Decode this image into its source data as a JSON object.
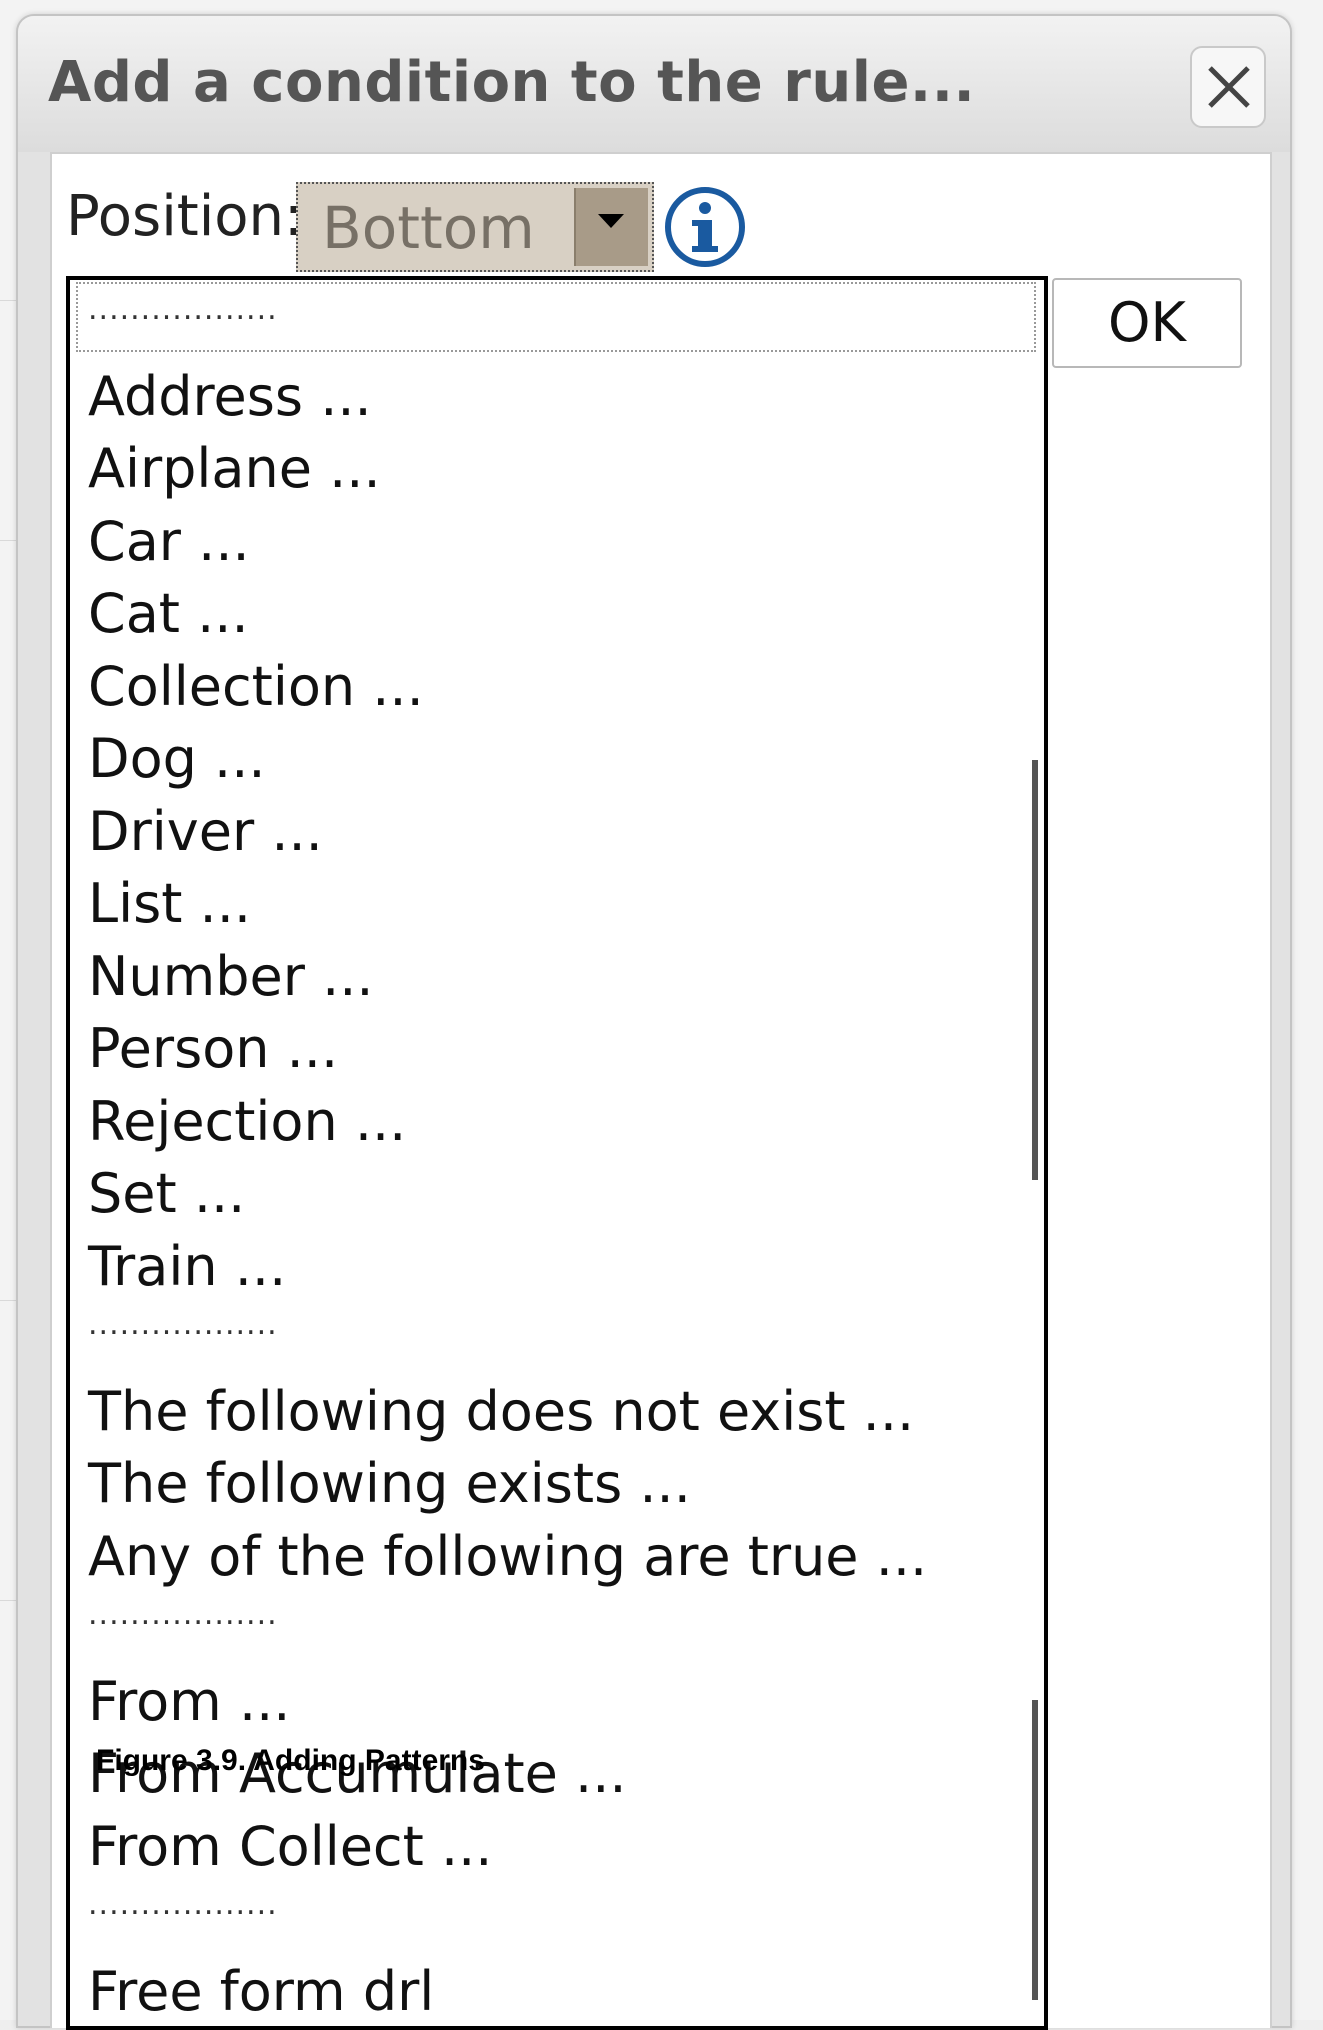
{
  "dialog": {
    "title": "Add a condition to the rule...",
    "close_icon": "close-icon"
  },
  "position": {
    "label": "Position:",
    "selected": "Bottom",
    "info_icon": "info-icon"
  },
  "ok_label": "OK",
  "pattern_list": {
    "separator_text": "..................",
    "items": [
      {
        "kind": "separator"
      },
      {
        "kind": "option",
        "label": "Address ..."
      },
      {
        "kind": "option",
        "label": "Airplane ..."
      },
      {
        "kind": "option",
        "label": "Car ..."
      },
      {
        "kind": "option",
        "label": "Cat ..."
      },
      {
        "kind": "option",
        "label": "Collection ..."
      },
      {
        "kind": "option",
        "label": "Dog ..."
      },
      {
        "kind": "option",
        "label": "Driver ..."
      },
      {
        "kind": "option",
        "label": "List ..."
      },
      {
        "kind": "option",
        "label": "Number ..."
      },
      {
        "kind": "option",
        "label": "Person ..."
      },
      {
        "kind": "option",
        "label": "Rejection ..."
      },
      {
        "kind": "option",
        "label": "Set ..."
      },
      {
        "kind": "option",
        "label": "Train ..."
      },
      {
        "kind": "separator"
      },
      {
        "kind": "option",
        "label": "The following does not exist ..."
      },
      {
        "kind": "option",
        "label": "The following exists ..."
      },
      {
        "kind": "option",
        "label": "Any of the following are true ..."
      },
      {
        "kind": "separator"
      },
      {
        "kind": "option",
        "label": "From ..."
      },
      {
        "kind": "option",
        "label": "From Accumulate ..."
      },
      {
        "kind": "option",
        "label": "From Collect ..."
      },
      {
        "kind": "separator"
      },
      {
        "kind": "option",
        "label": "Free form drl"
      }
    ]
  },
  "caption": "Figure 3.9. Adding Patterns",
  "colors": {
    "select_bg": "#d8d0c4",
    "info_blue": "#1a5aa0",
    "title_text": "#555555"
  }
}
